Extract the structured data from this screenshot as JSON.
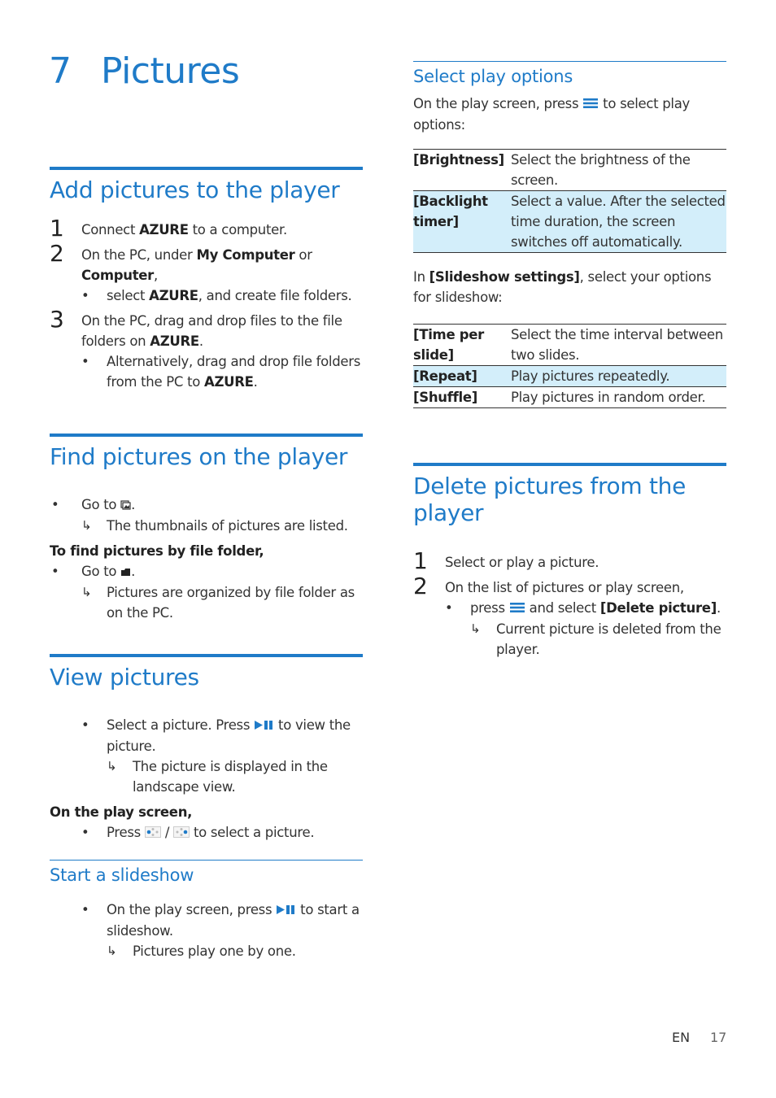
{
  "chapter": {
    "number": "7",
    "title": "Pictures"
  },
  "add": {
    "heading": "Add pictures to the player",
    "steps": [
      {
        "n": "1",
        "parts": [
          "Connect ",
          "AZURE",
          " to a computer."
        ]
      },
      {
        "n": "2",
        "parts": [
          "On the PC, under ",
          "My Computer",
          " or ",
          "Computer",
          ","
        ]
      },
      {
        "bullet": [
          "select ",
          "AZURE",
          ", and create file folders."
        ]
      },
      {
        "n": "3",
        "parts": [
          "On the PC, drag and drop files to the file folders on ",
          "AZURE",
          "."
        ]
      },
      {
        "bullet": [
          "Alternatively, drag and drop file folders from the PC to ",
          "AZURE",
          "."
        ]
      }
    ]
  },
  "find": {
    "heading": "Find pictures on the player",
    "b1": [
      "Go to ",
      "."
    ],
    "r1": "The thumbnails of pictures are listed.",
    "subhead": "To find pictures by file folder,",
    "b2": [
      "Go to ",
      "."
    ],
    "r2": "Pictures are organized by file folder as on the PC."
  },
  "view": {
    "heading": "View pictures",
    "b1": [
      "Select a picture. Press ",
      " to view the picture."
    ],
    "r1": "The picture is displayed in the landscape view.",
    "subhead": "On the play screen,",
    "b2": [
      "Press ",
      " / ",
      " to select a picture."
    ]
  },
  "slideshow": {
    "heading": "Start a slideshow",
    "b1": [
      "On the play screen, press ",
      " to start a slideshow."
    ],
    "r1": "Pictures play one by one."
  },
  "play_options": {
    "heading": "Select play options",
    "intro": [
      "On the play screen, press ",
      " to select play options:"
    ],
    "rows": [
      {
        "key": "[Brightness]",
        "value": "Select the brightness of the screen.",
        "highlight": false
      },
      {
        "key": "[Backlight timer]",
        "value": "Select a value. After the selected time duration, the screen switches off automatically.",
        "highlight": true
      }
    ],
    "slideshow_intro": [
      "In ",
      "[Slideshow settings]",
      ", select your options for slideshow:"
    ],
    "slideshow_rows": [
      {
        "key": "[Time per slide]",
        "value": "Select the time interval between two slides.",
        "highlight": false
      },
      {
        "key": "[Repeat]",
        "value": "Play pictures repeatedly.",
        "highlight": true
      },
      {
        "key": "[Shuffle]",
        "value": "Play pictures in random order.",
        "highlight": false
      }
    ]
  },
  "delete": {
    "heading": "Delete pictures from the player",
    "s1": {
      "n": "1",
      "text": "Select or play a picture."
    },
    "s2": {
      "n": "2",
      "text": "On the list of pictures or play screen,"
    },
    "b1": [
      "press ",
      " and select ",
      "[Delete picture]",
      "."
    ],
    "r1": "Current picture is deleted from the player."
  },
  "footer": {
    "lang": "EN",
    "page": "17"
  },
  "symbols": {
    "bullet": "•",
    "arrow": "↳"
  },
  "colors": {
    "accent": "#1f7bc8",
    "highlight_row": "#d3eefa"
  }
}
